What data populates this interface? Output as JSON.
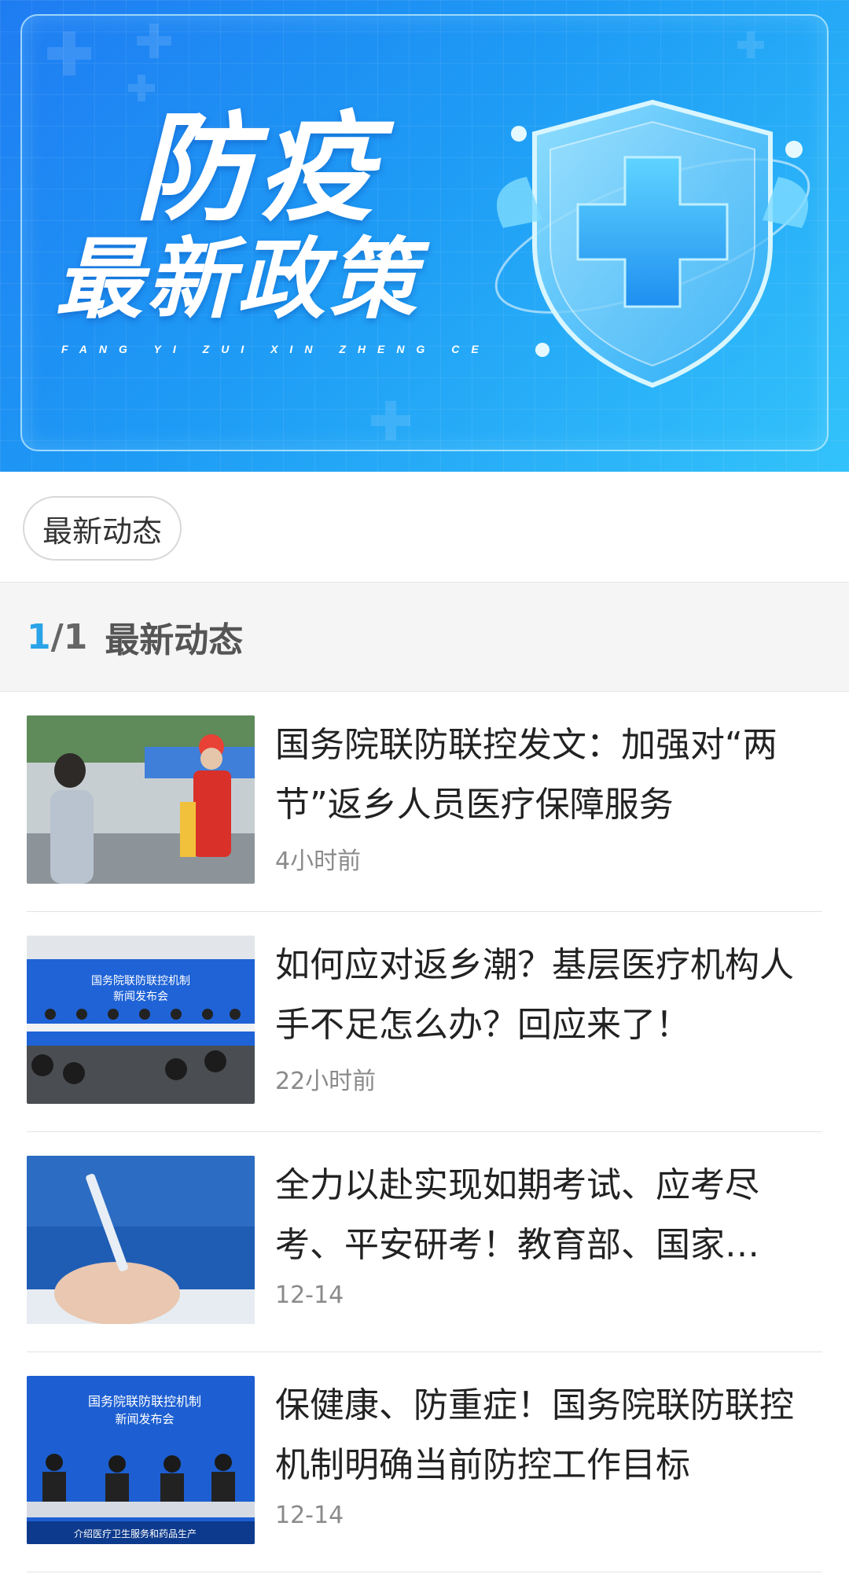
{
  "banner": {
    "title_line1": "防疫",
    "title_line2": "最新政策",
    "pinyin": "FANG YI ZUI XIN ZHENG CE"
  },
  "filter": {
    "chip_label": "最新动态"
  },
  "section": {
    "page_current": "1",
    "page_total": "/1",
    "title": "最新动态"
  },
  "news": [
    {
      "title": "国务院联防联控发文：加强对“两节”返乡人员医疗保障服务",
      "time": "4小时前"
    },
    {
      "title": "如何应对返乡潮？基层医疗机构人手不足怎么办？回应来了！",
      "time": "22小时前"
    },
    {
      "title": "全力以赴实现如期考试、应考尽考、平安研考！教育部、国家…",
      "time": "12-14"
    },
    {
      "title": "保健康、防重症！国务院联防联控机制明确当前防控工作目标",
      "time": "12-14",
      "thumb_text": {
        "line1": "国务院联防联控机制",
        "line2": "新闻发布会",
        "caption": "介绍医疗卫生服务和药品生产"
      }
    }
  ],
  "thumb2_text": {
    "line1": "国务院联防联控机制",
    "line2": "新闻发布会"
  },
  "colors": {
    "accent": "#2aa3e8",
    "banner_start": "#1f7cf2",
    "banner_end": "#33c3fb"
  }
}
